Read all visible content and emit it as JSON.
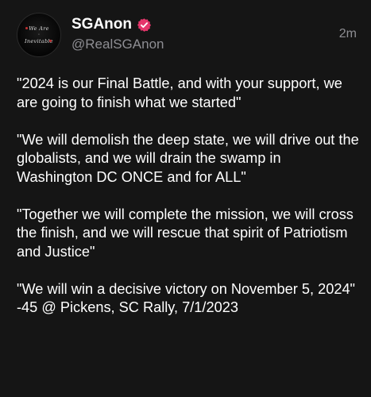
{
  "post": {
    "author": {
      "display_name": "SGAnon",
      "handle": "@RealSGAnon",
      "avatar_text": [
        "We Are",
        "Inevitable"
      ]
    },
    "timestamp": "2m",
    "verified_icon": "verified-badge-icon",
    "colors": {
      "background": "#151515",
      "text": "#ffffff",
      "secondary_text": "#8e8e93",
      "verified": "#e5366b"
    },
    "paragraphs": [
      "\"2024 is our Final Battle, and with your support, we are going to finish what we started\"",
      "\"We will demolish the deep state, we will drive out the globalists, and we will drain the swamp in Washington DC ONCE and for ALL\"",
      "\"Together we will complete the mission, we will cross the finish, and we will rescue that spirit of Patriotism and Justice\"",
      "\"We will win a decisive victory on November 5, 2024\"\n-45 @ Pickens, SC Rally, 7/1/2023"
    ]
  }
}
